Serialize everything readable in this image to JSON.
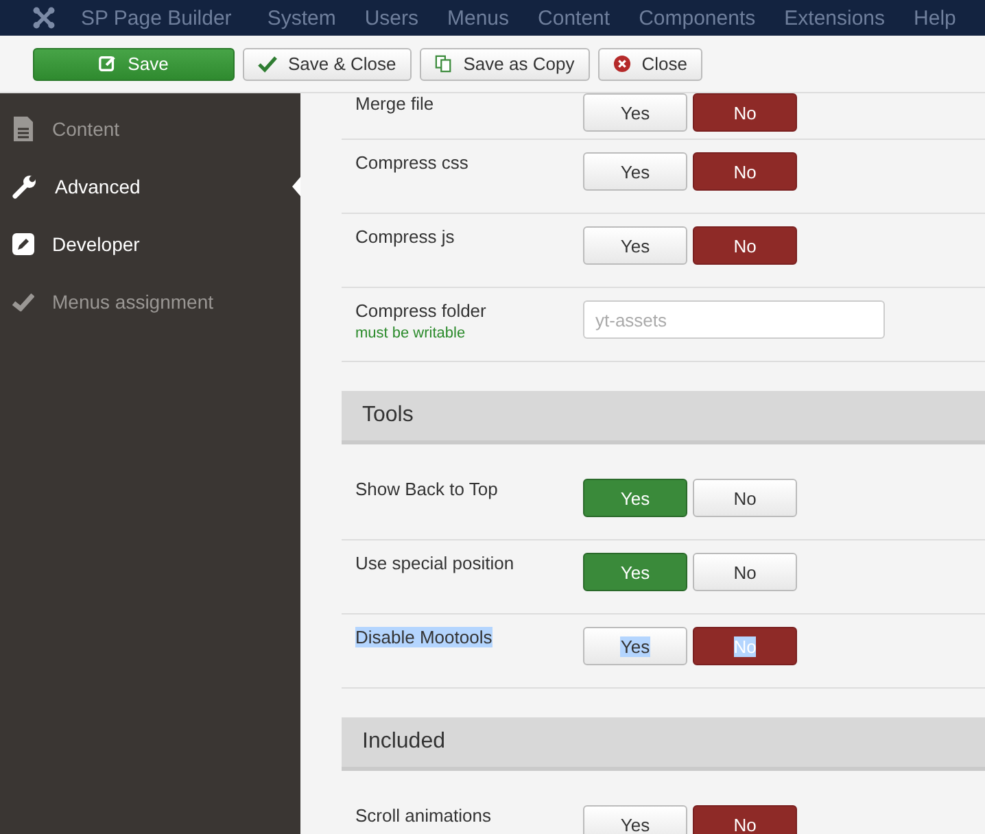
{
  "menubar": {
    "brand": "SP Page Builder",
    "items": [
      "System",
      "Users",
      "Menus",
      "Content",
      "Components",
      "Extensions",
      "Help"
    ]
  },
  "toolbar": [
    {
      "kind": "save",
      "label": "Save"
    },
    {
      "kind": "save-close",
      "label": "Save & Close"
    },
    {
      "kind": "copy",
      "label": "Save as Copy"
    },
    {
      "kind": "close",
      "label": "Close"
    }
  ],
  "sidebar": [
    {
      "kind": "document",
      "label": "Content",
      "selected": false,
      "dim": true
    },
    {
      "kind": "wrench",
      "label": "Advanced",
      "selected": true,
      "dim": false
    },
    {
      "kind": "edit",
      "label": "Developer",
      "selected": false,
      "dim": false
    },
    {
      "kind": "check",
      "label": "Menus assignment",
      "selected": false,
      "dim": true
    }
  ],
  "sections": [
    {
      "kind": "fields",
      "rows": [
        {
          "kind": "toggle",
          "label": "Merge file",
          "highlighted": false,
          "options": [
            {
              "label": "Yes",
              "selected": false
            },
            {
              "label": "No",
              "selected": true
            }
          ]
        },
        {
          "kind": "toggle",
          "label": "Compress css",
          "highlighted": false,
          "options": [
            {
              "label": "Yes",
              "selected": false
            },
            {
              "label": "No",
              "selected": true
            }
          ]
        },
        {
          "kind": "toggle",
          "label": "Compress js",
          "highlighted": false,
          "options": [
            {
              "label": "Yes",
              "selected": false
            },
            {
              "label": "No",
              "selected": true
            }
          ]
        },
        {
          "kind": "text",
          "label": "Compress folder",
          "note": "must be writable",
          "placeholder": "yt-assets",
          "highlighted": false
        }
      ]
    },
    {
      "kind": "group",
      "title": "Tools",
      "rows": [
        {
          "kind": "toggle",
          "label": "Show Back to Top",
          "highlighted": false,
          "options": [
            {
              "label": "Yes",
              "selected": true
            },
            {
              "label": "No",
              "selected": false
            }
          ]
        },
        {
          "kind": "toggle",
          "label": "Use special position",
          "highlighted": false,
          "options": [
            {
              "label": "Yes",
              "selected": true
            },
            {
              "label": "No",
              "selected": false
            }
          ]
        },
        {
          "kind": "toggle",
          "label": "Disable Mootools",
          "highlighted": true,
          "options": [
            {
              "label": "Yes",
              "selected": false
            },
            {
              "label": "No",
              "selected": true
            }
          ]
        }
      ]
    },
    {
      "kind": "group",
      "title": "Included",
      "rows": [
        {
          "kind": "toggle",
          "label": "Scroll animations",
          "highlighted": false,
          "options": [
            {
              "label": "Yes",
              "selected": false
            },
            {
              "label": "No",
              "selected": true
            }
          ]
        }
      ]
    }
  ]
}
